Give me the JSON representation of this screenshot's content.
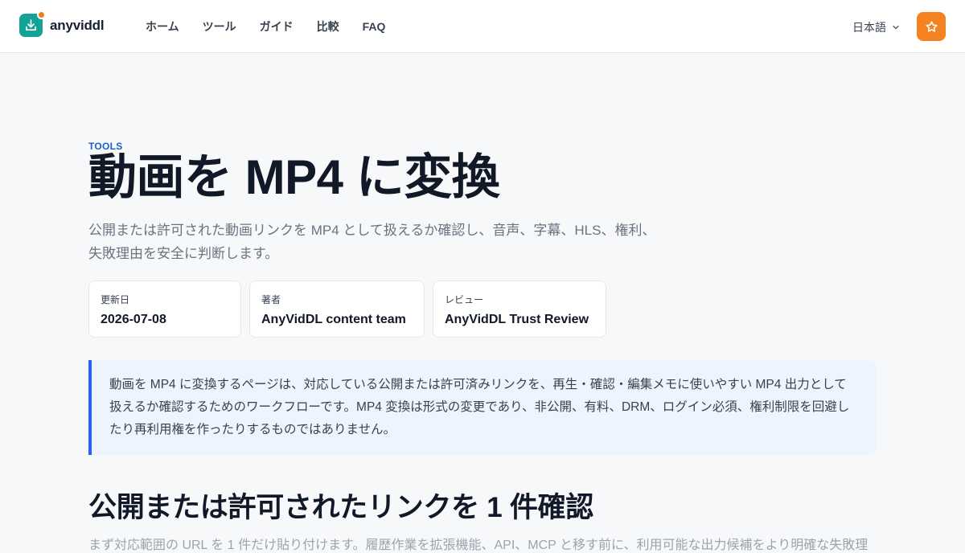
{
  "header": {
    "brand": "anyviddl",
    "nav": [
      "ホーム",
      "ツール",
      "ガイド",
      "比較",
      "FAQ"
    ],
    "language": "日本語",
    "colors": {
      "brand": "#14a196",
      "accent": "#f58220"
    }
  },
  "page": {
    "eyebrow": "TOOLS",
    "title": "動画を MP4 に変換",
    "lead": "公開または許可された動画リンクを MP4 として扱えるか確認し、音声、字幕、HLS、権利、失敗理由を安全に判断します。",
    "meta": [
      {
        "label": "更新日",
        "value": "2026-07-08"
      },
      {
        "label": "著者",
        "value": "AnyVidDL content team"
      },
      {
        "label": "レビュー",
        "value": "AnyVidDL Trust Review"
      }
    ],
    "callout": "動画を MP4 に変換するページは、対応している公開または許可済みリンクを、再生・確認・編集メモに使いやすい MP4 出力として扱えるか確認するためのワークフローです。MP4 変換は形式の変更であり、非公開、有料、DRM、ログイン必須、権利制限を回避したり再利用権を作ったりするものではありません。",
    "section_title": "公開または許可されたリンクを 1 件確認",
    "section_text": "まず対応範囲の URL を 1 件だけ貼り付けます。履歴作業を拡張機能、API、MCP と移す前に、利用可能な出力候補をより明確な失敗理"
  }
}
